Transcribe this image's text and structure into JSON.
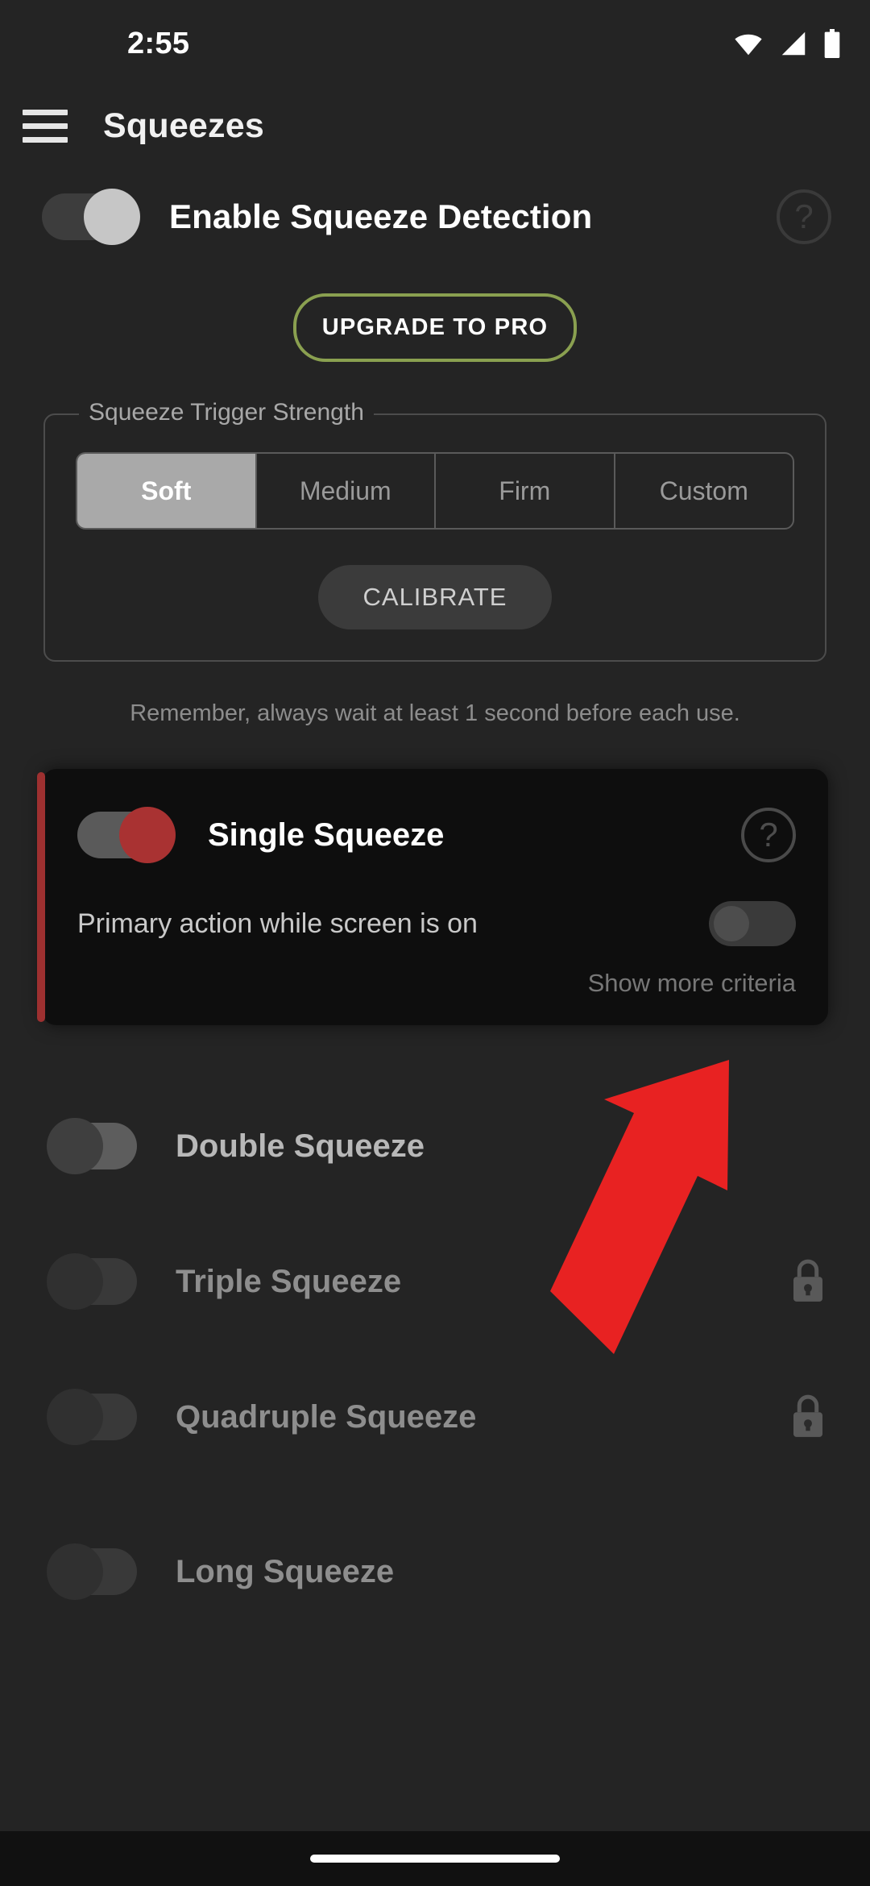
{
  "status_bar": {
    "time": "2:55",
    "icons": [
      "wifi-icon",
      "cell-signal-icon",
      "battery-icon"
    ]
  },
  "app_bar": {
    "menu_icon": "hamburger-menu-icon",
    "title": "Squeezes"
  },
  "master_toggle": {
    "label": "Enable Squeeze Detection",
    "state": "on",
    "help_icon": "help-circle-icon"
  },
  "upgrade": {
    "label": "UPGRADE TO PRO",
    "border_color": "#8aa050"
  },
  "trigger_strength": {
    "legend": "Squeeze Trigger Strength",
    "options": [
      {
        "label": "Soft",
        "selected": true
      },
      {
        "label": "Medium",
        "selected": false
      },
      {
        "label": "Firm",
        "selected": false
      },
      {
        "label": "Custom",
        "selected": false
      }
    ],
    "calibrate_label": "CALIBRATE"
  },
  "hint": "Remember, always wait at least 1 second before each use.",
  "single_squeeze_card": {
    "title": "Single Squeeze",
    "toggle_state": "on",
    "toggle_color": "#a93232",
    "accent_color": "#9d3030",
    "help_icon": "help-circle-icon",
    "sub_label": "Primary action while screen is on",
    "sub_toggle_state": "off",
    "show_criteria_label": "Show more criteria"
  },
  "gesture_rows": [
    {
      "title": "Double Squeeze",
      "toggle_state": "off",
      "locked": false,
      "dim": false
    },
    {
      "title": "Triple Squeeze",
      "toggle_state": "off",
      "locked": true,
      "dim": true
    },
    {
      "title": "Quadruple Squeeze",
      "toggle_state": "off",
      "locked": true,
      "dim": true
    },
    {
      "title": "Long Squeeze",
      "toggle_state": "off",
      "locked": false,
      "dim": true
    }
  ],
  "annotation": {
    "type": "arrow",
    "color": "#e82222",
    "points_to": "primary-action-toggle"
  },
  "nav_bar": {
    "pill": "gesture-home-pill"
  }
}
